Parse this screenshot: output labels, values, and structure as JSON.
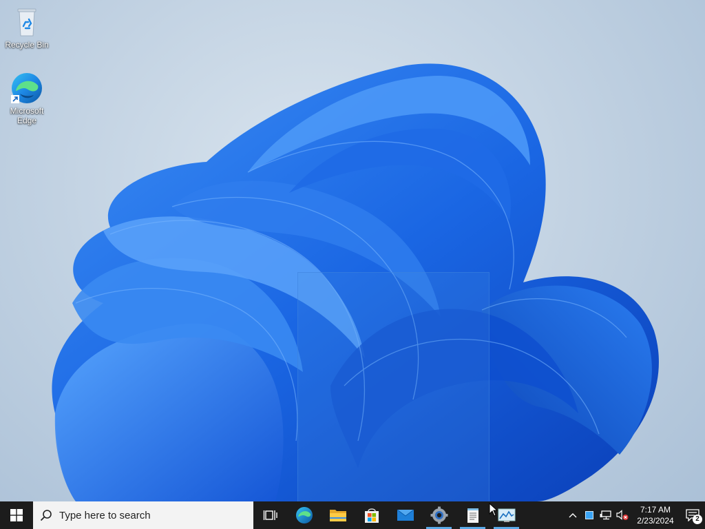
{
  "desktop": {
    "icons": [
      {
        "label": "Recycle Bin",
        "icon": "recycle-bin-icon"
      },
      {
        "label": "Microsoft Edge",
        "icon": "edge-icon"
      }
    ]
  },
  "taskbar": {
    "search_placeholder": "Type here to search",
    "apps": [
      {
        "name": "task-view",
        "icon": "task-view-icon",
        "running": false
      },
      {
        "name": "edge",
        "icon": "edge-icon",
        "running": false
      },
      {
        "name": "file-explorer",
        "icon": "folder-icon",
        "running": false
      },
      {
        "name": "microsoft-store",
        "icon": "store-icon",
        "running": false
      },
      {
        "name": "mail",
        "icon": "mail-icon",
        "running": false
      },
      {
        "name": "settings",
        "icon": "gear-icon",
        "running": true
      },
      {
        "name": "notepad",
        "icon": "notepad-icon",
        "running": true
      },
      {
        "name": "resource-monitor",
        "icon": "monitor-chart-icon",
        "running": true
      }
    ],
    "tray": {
      "time": "7:17 AM",
      "date": "2/23/2024",
      "notification_count": "2"
    }
  },
  "colors": {
    "taskbar_bg": "#1c1c1c",
    "accent": "#0078d4",
    "wallpaper_bloom": "#1565e0"
  }
}
